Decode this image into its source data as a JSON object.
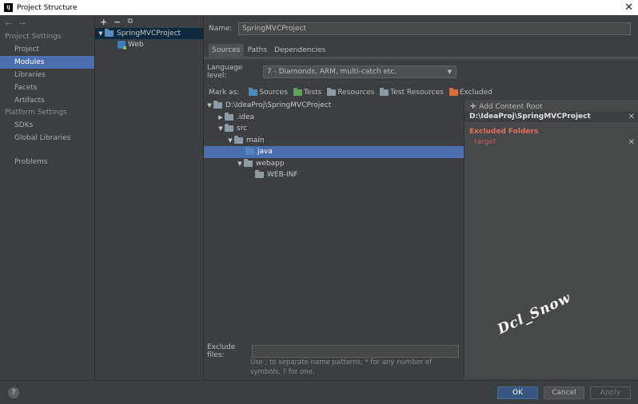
{
  "window": {
    "title": "Project Structure",
    "close_glyph": "✕"
  },
  "sidebar": {
    "project_settings_label": "Project Settings",
    "project_items": [
      "Project",
      "Modules",
      "Libraries",
      "Facets",
      "Artifacts"
    ],
    "selected": "Modules",
    "platform_settings_label": "Platform Settings",
    "platform_items": [
      "SDKs",
      "Global Libraries"
    ],
    "problems_label": "Problems"
  },
  "module_tree": {
    "toolbar": {
      "add": "+",
      "remove": "−",
      "copy": "⧉"
    },
    "project": "SpringMVCProject",
    "child": "Web"
  },
  "main": {
    "name_label": "Name:",
    "name_value": "SpringMVCProject",
    "tabs": [
      "Sources",
      "Paths",
      "Dependencies"
    ],
    "active_tab": "Sources",
    "language_level_label": "Language level:",
    "language_level_value": "7 - Diamonds, ARM, multi-catch etc.",
    "mark_as_label": "Mark as:",
    "mark_as": [
      "Sources",
      "Tests",
      "Resources",
      "Test Resources",
      "Excluded"
    ],
    "tree": {
      "root": "D:\\IdeaProj\\SpringMVCProject",
      "idea": ".idea",
      "src": "src",
      "main": "main",
      "java": "java",
      "webapp": "webapp",
      "webinf": "WEB-INF"
    },
    "exclude_files_label": "Exclude files:",
    "exclude_files_value": "",
    "exclude_hint": "Use ; to separate name patterns, * for any number of symbols, ? for one."
  },
  "roots_panel": {
    "add_content_root": "Add Content Root",
    "root_path": "D:\\IdeaProj\\SpringMVCProject",
    "excluded_title": "Excluded Folders",
    "excluded_items": [
      "target"
    ],
    "watermark": "Dcl_Snow"
  },
  "footer": {
    "help": "?",
    "ok": "OK",
    "cancel": "Cancel",
    "apply": "Apply"
  },
  "colors": {
    "background": "#3c3f41",
    "selection": "#4b6eaf",
    "excluded": "#e36c5a",
    "ok_button": "#365880"
  }
}
